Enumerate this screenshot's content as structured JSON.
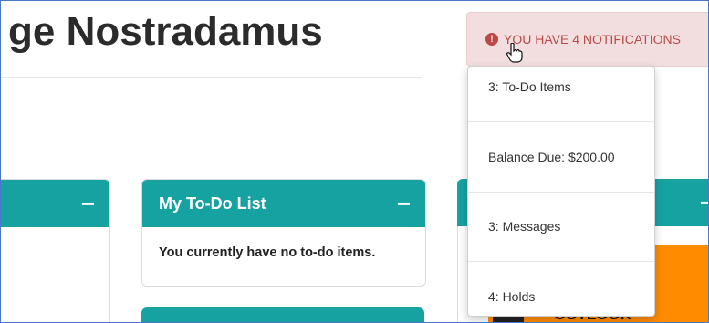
{
  "page": {
    "title": "ge Nostradamus"
  },
  "panels": {
    "left": {
      "collapse_label": "−"
    },
    "todo": {
      "title": "My To-Do List",
      "collapse_label": "−",
      "message": "You currently have no to-do items."
    },
    "right": {
      "collapse_label": "−",
      "tile_label": "OUTLOOK"
    }
  },
  "notifications": {
    "button_label": "YOU HAVE 4 NOTIFICATIONS",
    "icon": "exclamation-circle-icon",
    "items": [
      {
        "label": "3: To-Do Items"
      },
      {
        "label": "Balance Due: $200.00"
      },
      {
        "label": "3: Messages"
      },
      {
        "label": "4: Holds"
      }
    ]
  },
  "colors": {
    "panel_header": "#17a2a2",
    "alert_bg": "#f2dede",
    "alert_text": "#b94a48",
    "tile_orange": "#ff8c00"
  }
}
